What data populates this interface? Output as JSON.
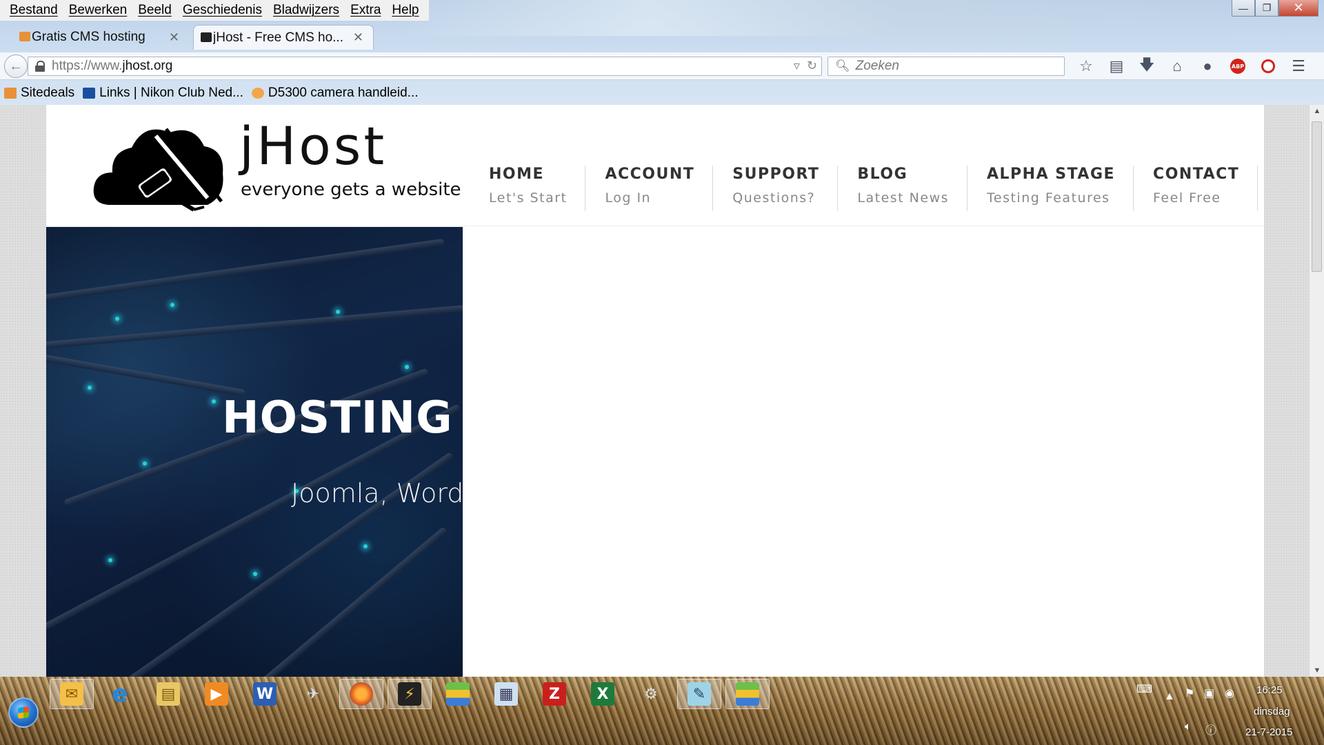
{
  "browser": {
    "menu": [
      "Bestand",
      "Bewerken",
      "Beeld",
      "Geschiedenis",
      "Bladwijzers",
      "Extra",
      "Help"
    ],
    "tabs": [
      {
        "label": "Gratis CMS hosting",
        "active": false,
        "favicon_color": "#e8913a"
      },
      {
        "label": "jHost - Free CMS ho...",
        "active": true,
        "favicon_color": "#222222"
      }
    ],
    "new_tab": "+",
    "url_prefix": "https://www.",
    "url_domain": "jhost.org",
    "search_placeholder": "Zoeken",
    "bookmarks": [
      {
        "label": "Sitedeals",
        "icon_color": "#e8913a"
      },
      {
        "label": "Links | Nikon Club Ned...",
        "icon_color": "#1a4fa0"
      },
      {
        "label": "D5300 camera handleid...",
        "icon_color": "#f2a54a"
      }
    ],
    "toolbar_icons": [
      "star-icon",
      "reading-list-icon",
      "download-icon",
      "home-icon",
      "chat-icon",
      "adblock-icon",
      "opera-icon",
      "menu-icon"
    ],
    "abp_label": "ABP"
  },
  "site": {
    "logo_title": "jHost",
    "logo_tagline": "everyone gets a website",
    "nav": [
      {
        "title": "HOME",
        "sub": "Let's Start"
      },
      {
        "title": "ACCOUNT",
        "sub": "Log In"
      },
      {
        "title": "SUPPORT",
        "sub": "Questions?"
      },
      {
        "title": "BLOG",
        "sub": "Latest News"
      },
      {
        "title": "ALPHA STAGE",
        "sub": "Testing Features"
      },
      {
        "title": "CONTACT",
        "sub": "Feel Free"
      }
    ],
    "hero_title": "HOSTING Y",
    "hero_subtitle": "Joomla, Word"
  },
  "taskbar": {
    "apps": [
      "outlook-icon",
      "internet-explorer-icon",
      "file-explorer-icon",
      "media-player-icon",
      "word-icon",
      "airplane-app-icon",
      "firefox-icon",
      "lightning-app-icon",
      "bluestacks-icon",
      "calculator-icon",
      "filezilla-icon",
      "excel-icon",
      "gear-app-icon",
      "notepad-app-icon",
      "bluestacks-2-icon"
    ],
    "pressed": [
      0,
      6,
      7,
      13,
      14
    ],
    "time": "16:25",
    "day": "dinsdag",
    "date": "21-7-2015"
  }
}
